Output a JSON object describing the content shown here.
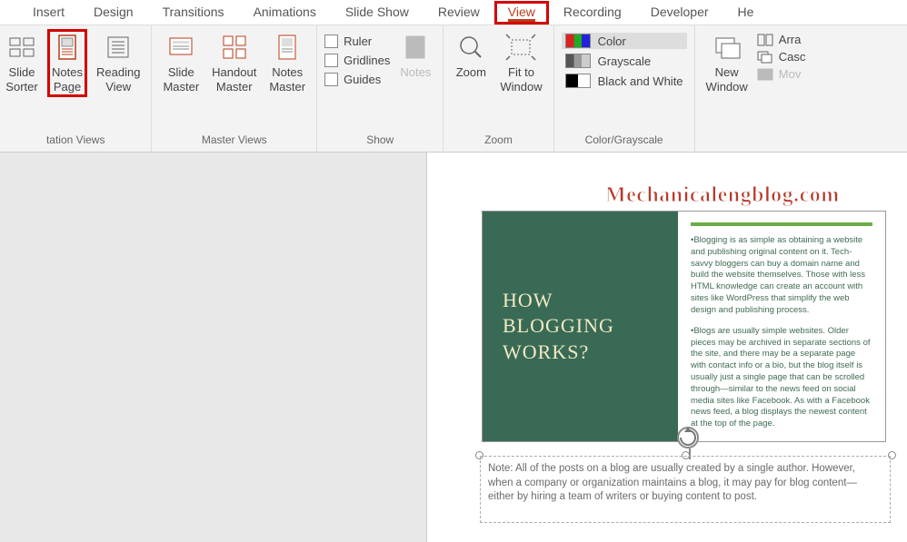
{
  "tabs": {
    "insert": "Insert",
    "design": "Design",
    "transitions": "Transitions",
    "animations": "Animations",
    "slideshow": "Slide Show",
    "review": "Review",
    "view": "View",
    "recording": "Recording",
    "developer": "Developer",
    "help": "He"
  },
  "ribbon": {
    "presentation_views": {
      "slide_sorter": "Slide\nSorter",
      "notes_page": "Notes\nPage",
      "reading_view": "Reading\nView",
      "group_label": "tation Views"
    },
    "master_views": {
      "slide_master": "Slide\nMaster",
      "handout_master": "Handout\nMaster",
      "notes_master": "Notes\nMaster",
      "group_label": "Master Views"
    },
    "show": {
      "ruler": "Ruler",
      "gridlines": "Gridlines",
      "guides": "Guides",
      "notes": "Notes",
      "group_label": "Show"
    },
    "zoom": {
      "zoom": "Zoom",
      "fit": "Fit to\nWindow",
      "group_label": "Zoom"
    },
    "colorgray": {
      "color": "Color",
      "grayscale": "Grayscale",
      "bw": "Black and White",
      "group_label": "Color/Grayscale"
    },
    "window": {
      "new_window": "New\nWindow",
      "arrange": "Arra",
      "cascade": "Casc",
      "move": "Mov"
    }
  },
  "watermark": "Mechanicalengblog.com",
  "slide": {
    "title": "HOW BLOGGING WORKS?",
    "para1": "•Blogging is as simple as obtaining a website and publishing original content on it. Tech-savvy bloggers can buy a domain name and build the website themselves. Those with less HTML knowledge can create an account with sites like WordPress that simplify the web design and publishing process.",
    "para2": "•Blogs are usually simple websites. Older pieces may be archived in separate sections of the site, and there may be a separate page with contact info or a bio, but the blog itself is usually just a single page that can be scrolled through—similar to the news feed on social media sites like Facebook. As with a Facebook news feed, a blog displays the newest content at the top of the page."
  },
  "notes": {
    "text": "Note: All of the posts on a blog are usually created by a single author. However, when a company or organization maintains a blog, it may pay for blog content—either by hiring a team of writers or buying content to post."
  }
}
